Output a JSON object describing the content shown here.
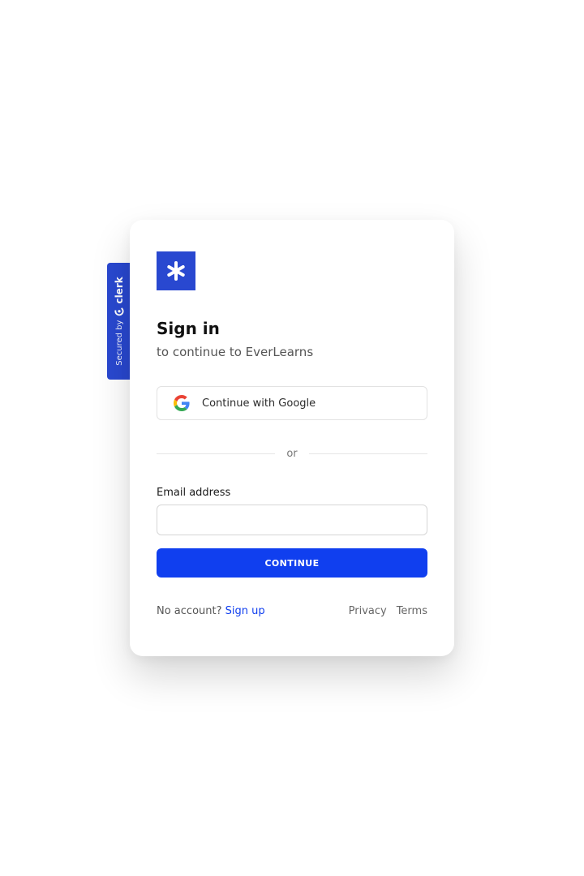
{
  "secured_badge": {
    "prefix": "Secured by",
    "brand": "clerk",
    "brand_icon": "clerk-logo-icon",
    "background": "#2948d0"
  },
  "app": {
    "logo_icon": "asterisk-logo-icon",
    "logo_color": "#2948d0"
  },
  "sign_in": {
    "title": "Sign in",
    "subtitle": "to continue to EverLearns"
  },
  "google_button": {
    "icon": "google-icon",
    "label": "Continue with Google"
  },
  "divider": {
    "label": "or"
  },
  "email": {
    "label": "Email address",
    "value": "",
    "placeholder": ""
  },
  "continue_button": {
    "label": "CONTINUE",
    "color": "#103fef"
  },
  "footer": {
    "no_account_text": "No account?",
    "signup_label": "Sign up",
    "privacy_label": "Privacy",
    "terms_label": "Terms"
  }
}
